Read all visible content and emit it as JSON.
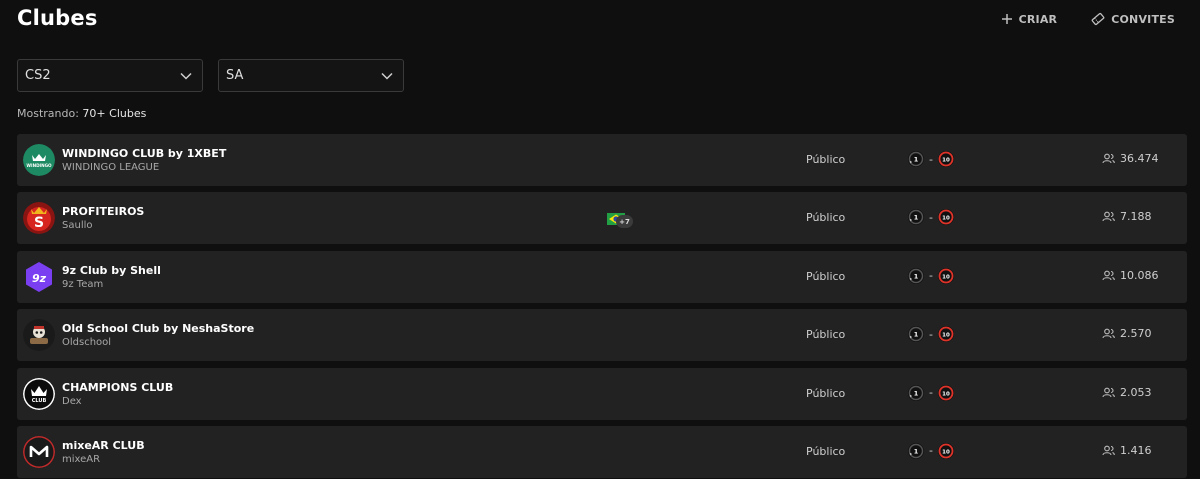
{
  "page": {
    "title": "Clubes"
  },
  "header": {
    "create_label": "CRIAR",
    "invites_label": "CONVITES"
  },
  "filters": {
    "game": "CS2",
    "region": "SA"
  },
  "summary": {
    "prefix": "Mostrando:",
    "count": "70+ Clubes"
  },
  "clubs": [
    {
      "name": "WINDINGO CLUB by 1XBET",
      "owner": "WINDINGO LEAGUE",
      "privacy": "Público",
      "level_min": "1",
      "level_max": "10",
      "members": "36.474",
      "avatar_icon": "windingo-logo-icon",
      "avatar_text": "WINDINGO"
    },
    {
      "name": "PROFITEIROS",
      "owner": "Saullo",
      "privacy": "Público",
      "level_min": "1",
      "level_max": "10",
      "members": "7.188",
      "avatar_icon": "profiteiros-logo-icon",
      "avatar_text": "S",
      "flag_icon": "brazil-flag-icon",
      "extra_countries": "+7"
    },
    {
      "name": "9z Club by Shell",
      "owner": "9z Team",
      "privacy": "Público",
      "level_min": "1",
      "level_max": "10",
      "members": "10.086",
      "avatar_icon": "9z-logo-icon",
      "avatar_text": "9z"
    },
    {
      "name": "Old School Club by NeshaStore",
      "owner": "Oldschool",
      "privacy": "Público",
      "level_min": "1",
      "level_max": "10",
      "members": "2.570",
      "avatar_icon": "oldschool-logo-icon",
      "avatar_text": ""
    },
    {
      "name": "CHAMPIONS CLUB",
      "owner": "Dex",
      "privacy": "Público",
      "level_min": "1",
      "level_max": "10",
      "members": "2.053",
      "avatar_icon": "champions-crown-logo-icon",
      "avatar_text": "CLUB"
    },
    {
      "name": "mixeAR CLUB",
      "owner": "mixeAR",
      "privacy": "Público",
      "level_min": "1",
      "level_max": "10",
      "members": "1.416",
      "avatar_icon": "mixear-logo-icon",
      "avatar_text": ""
    }
  ],
  "colors": {
    "background": "#0f0f0f",
    "row": "#222222",
    "level_max_accent": "#e0342a",
    "level_min_ring": "#9a9a9a"
  }
}
